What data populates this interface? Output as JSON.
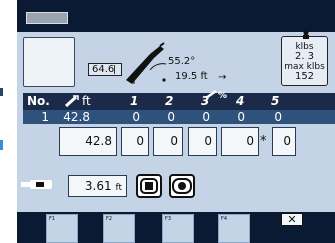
{
  "colors": {
    "bar": "#0a1a33",
    "panel": "#c4d4e6",
    "screen": "#5d8fc4",
    "header": "#1a2a48",
    "active_row": "#2f527c"
  },
  "boom": {
    "length": "64.6",
    "angle": "55.2°",
    "radius": "19.5 ft",
    "radius_arrow": "→"
  },
  "load": {
    "icon": "hook-weight-icon",
    "unit1": "klbs",
    "actual": "2. 3",
    "unit2": "max klbs",
    "max": "152"
  },
  "table": {
    "headers": {
      "no": "No.",
      "ft": "ft",
      "c1": "1",
      "c2": "2",
      "c3": "3",
      "c4": "4",
      "c5": "5",
      "pct": "%"
    },
    "row": {
      "no": "1",
      "ft": "42.8",
      "c1": "0",
      "c2": "0",
      "c3": "0",
      "c4": "0",
      "c5": "0"
    },
    "edit": {
      "ft": "42.8",
      "c1": "0",
      "c2": "0",
      "c3": "0",
      "c4": "0",
      "marker": "*",
      "c5": "0"
    }
  },
  "hook": {
    "value": "3.61",
    "unit": "ft"
  },
  "fkeys": {
    "f1": "F1",
    "f2": "F2",
    "f3": "F3",
    "f4": "F4",
    "close": "✕"
  }
}
